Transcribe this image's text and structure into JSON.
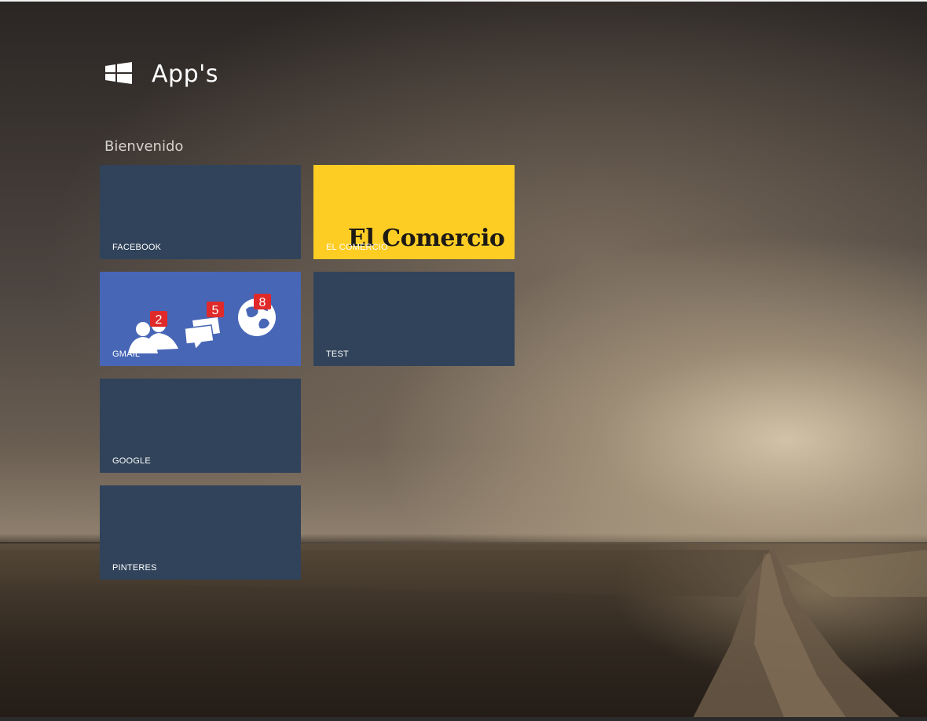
{
  "header": {
    "title": "App's",
    "logo_icon": "windows-logo-icon"
  },
  "group": {
    "title": "Bienvenido"
  },
  "tiles": [
    {
      "label": "FACEBOOK",
      "color": "#30435a"
    },
    {
      "label": "EL COMERCIO",
      "color": "#fdcd24",
      "brand_text": "El Comercio"
    },
    {
      "label": "GMAIL",
      "color": "#4766b6",
      "badges": [
        "2",
        "5",
        "8"
      ]
    },
    {
      "label": "TEST",
      "color": "#30435a"
    },
    {
      "label": "GOOGLE",
      "color": "#30435a"
    },
    {
      "label": "PINTERES",
      "color": "#30435a"
    }
  ],
  "icons": {
    "friends": "friend-requests-icon",
    "messages": "messages-icon",
    "notifications": "globe-notifications-icon"
  },
  "colors": {
    "tile_default": "#30435a",
    "tile_brand_yellow": "#fdcd24",
    "tile_facebook_blue": "#4766b6",
    "badge_red": "#e02a2a"
  }
}
